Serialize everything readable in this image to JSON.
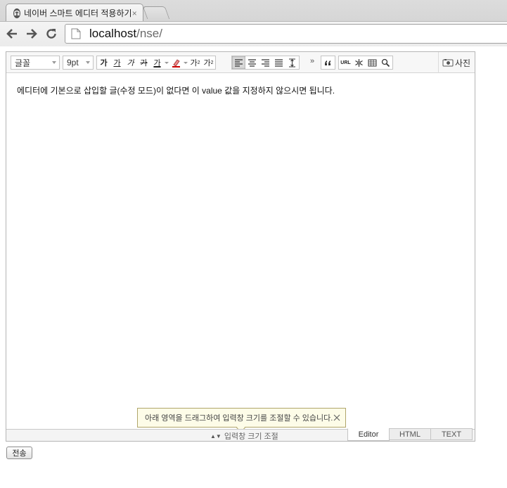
{
  "browser": {
    "tab_title": "네이버 스마트 에디터 적용하기",
    "tab_close": "×",
    "url_host": "localhost",
    "url_path": "/nse/"
  },
  "toolbar": {
    "font_family": "글꼴",
    "font_size": "9pt",
    "bold": "가",
    "underline": "가",
    "italic": "가",
    "strike": "가",
    "font_color": "가",
    "superscript": "가",
    "subscript": "가",
    "more": "»",
    "url": "URL",
    "photo_label": "사진"
  },
  "content": {
    "text": "에디터에 기본으로 삽입할 글(수정 모드)이 없다면 이 value 값을 지정하지 않으시면 됩니다."
  },
  "tooltip": {
    "text": "아래 영역을 드래그하여 입력창 크기를 조절할 수 있습니다."
  },
  "footer": {
    "resize_label": "입력창 크기 조절",
    "resize_arrows": "▲▼",
    "modes": [
      "Editor",
      "HTML",
      "TEXT"
    ]
  },
  "form": {
    "submit_label": "전송"
  }
}
